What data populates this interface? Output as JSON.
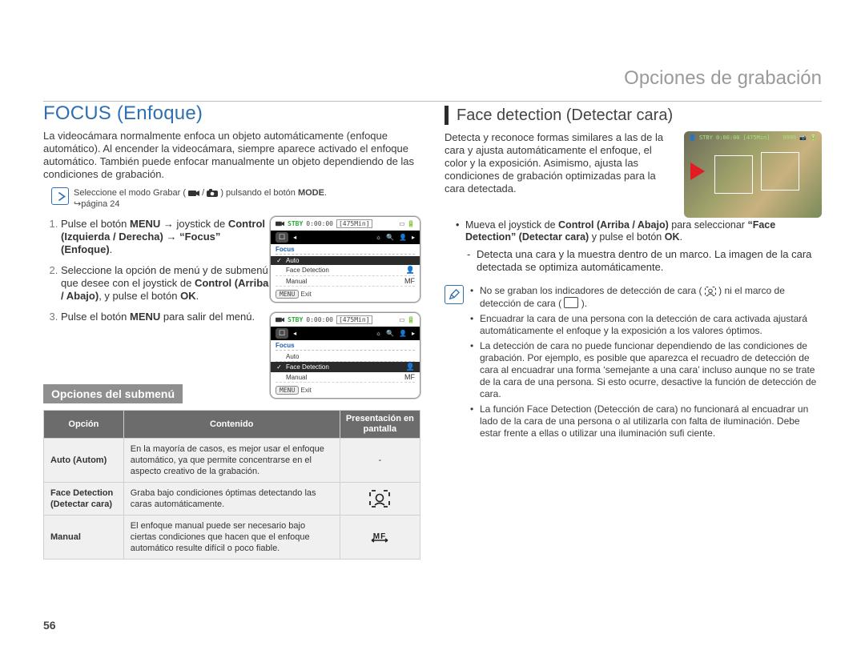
{
  "breadcrumb": "Opciones de grabación",
  "pageNumber": "56",
  "left": {
    "heading": "FOCUS (Enfoque)",
    "intro": "La videocámara normalmente enfoca un objeto automáticamente (enfoque automático). Al encender la videocámara, siempre aparece activado el enfoque automático. También puede enfocar manualmente un objeto dependiendo de las condiciones de grabación.",
    "modeNoteA": "Seleccione el modo Grabar (",
    "modeNoteB": ") pulsando el botón ",
    "modeNoteBold": "MODE",
    "modeNoteC": ".",
    "modeNoteD": "↪página 24",
    "step1a": "Pulse el botón ",
    "step1b": "MENU",
    "step1c": " → joystick de ",
    "step1d": "Control (Izquierda / Derecha)",
    "step1e": " → ",
    "step1f": "“Focus” (Enfoque)",
    "step1g": ".",
    "step2a": "Seleccione la opción de menú y de submenú que desee con el joystick de ",
    "step2b": "Control (Arriba / Abajo)",
    "step2c": ", y pulse el botón ",
    "step2d": "OK",
    "step2e": ".",
    "step3a": "Pulse el botón ",
    "step3b": "MENU",
    "step3c": " para salir del menú.",
    "subheading": "Opciones del submenú",
    "table": {
      "h1": "Opción",
      "h2": "Contenido",
      "h3": "Presentación en pantalla",
      "r1c1": "Auto (Autom)",
      "r1c2": "En la mayoría de casos, es mejor usar el enfoque automático, ya que permite concentrarse en el aspecto creativo de la grabación.",
      "r1c3": "-",
      "r2c1": "Face Detection (Detectar cara)",
      "r2c2": "Graba bajo condiciones óptimas detectando las caras automáticamente.",
      "r3c1": "Manual",
      "r3c2": "El enfoque manual puede ser necesario bajo ciertas condiciones que hacen que el enfoque automático resulte difícil o poco fiable."
    },
    "menu": {
      "stby": "STBY",
      "time": "0:00:00",
      "remain": "[475Min]",
      "title": "Focus",
      "items": [
        "Auto",
        "Face Detection",
        "Manual"
      ],
      "footBtn": "MENU",
      "footTxt": "Exit"
    }
  },
  "right": {
    "heading": "Face detection (Detectar cara)",
    "intro": "Detecta y reconoce formas similares a las de la cara y ajusta automáticamente el enfoque, el color y la exposición. Asimismo, ajusta las condiciones de grabación optimizadas para la cara detectada.",
    "move1": "Mueva el joystick de ",
    "move2": "Control (Arriba / Abajo)",
    "move3": " para seleccionar ",
    "move4": "“Face Detection” (Detectar cara)",
    "move5": " y pulse el botón ",
    "move6": "OK",
    "move7": ".",
    "dash1": "Detecta una cara y la muestra dentro de un marco. La imagen de la cara detectada se optimiza automáticamente.",
    "thumb": {
      "stby": "STBY",
      "time": "0:00:00",
      "remain": "[475Min]",
      "count": "9999"
    },
    "notes": [
      "No se graban los indicadores de detección de cara ( 👤 ) ni el marco de detección de cara ( ▭ ).",
      "Encuadrar la cara de una persona con la detección de cara activada ajustará automáticamente el enfoque y la exposición a los valores óptimos.",
      "La detección de cara no puede funcionar dependiendo de las condiciones de grabación. Por ejemplo, es posible que aparezca el recuadro de detección de cara al encuadrar una forma ‘semejante a una cara’ incluso aunque no se trate de la cara de una persona. Si esto ocurre, desactive la función de detección de cara.",
      "La función Face Detection (Detección de cara) no funcionará al encuadrar un lado de la cara de una persona o al utilizarla con falta de iluminación. Debe estar frente a ellas o utilizar una iluminación sufi ciente."
    ]
  }
}
